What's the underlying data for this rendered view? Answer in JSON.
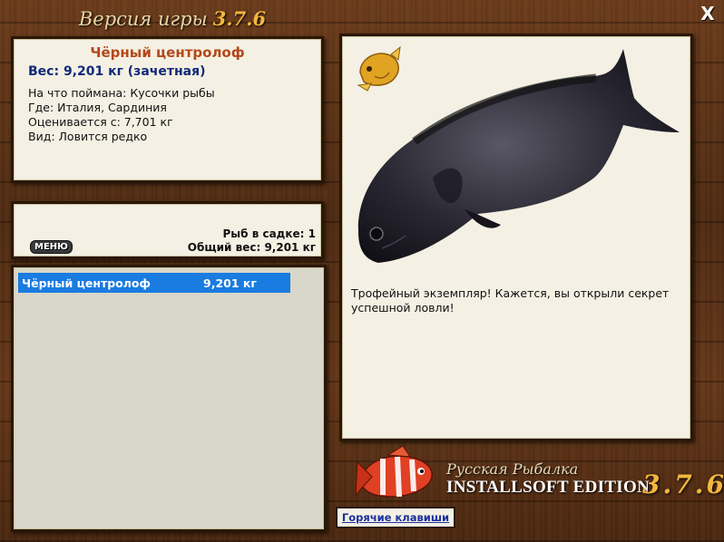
{
  "header": {
    "title": "Версия игры",
    "version": "3.7.6"
  },
  "close_label": "X",
  "catch_info": {
    "name": "Чёрный центролоф",
    "weight": "Вес: 9,201 кг (зачетная)",
    "lines": [
      "На что поймана: Кусочки рыбы",
      "Где: Италия, Сардиния",
      "Оценивается с: 7,701 кг",
      "Вид: Ловится редко"
    ]
  },
  "keepnet": {
    "menu_label": "МЕНЮ",
    "count": "Рыб в садке: 1",
    "total_weight": "Общий вес: 9,201 кг"
  },
  "list": [
    {
      "name": "Чёрный центролоф",
      "weight": "9,201 кг"
    }
  ],
  "message": "Трофейный экземпляр! Кажется, вы открыли секрет успешной ловли!",
  "branding": {
    "subtitle": "Русская Рыбалка",
    "edition": "INSTALLSOFT EDITION",
    "version": "3.7.6"
  },
  "hotkeys_label": "Горячие клавиши",
  "colors": {
    "selection": "#1a7be0",
    "fish_name": "#b5471a",
    "weight": "#122a7a"
  }
}
